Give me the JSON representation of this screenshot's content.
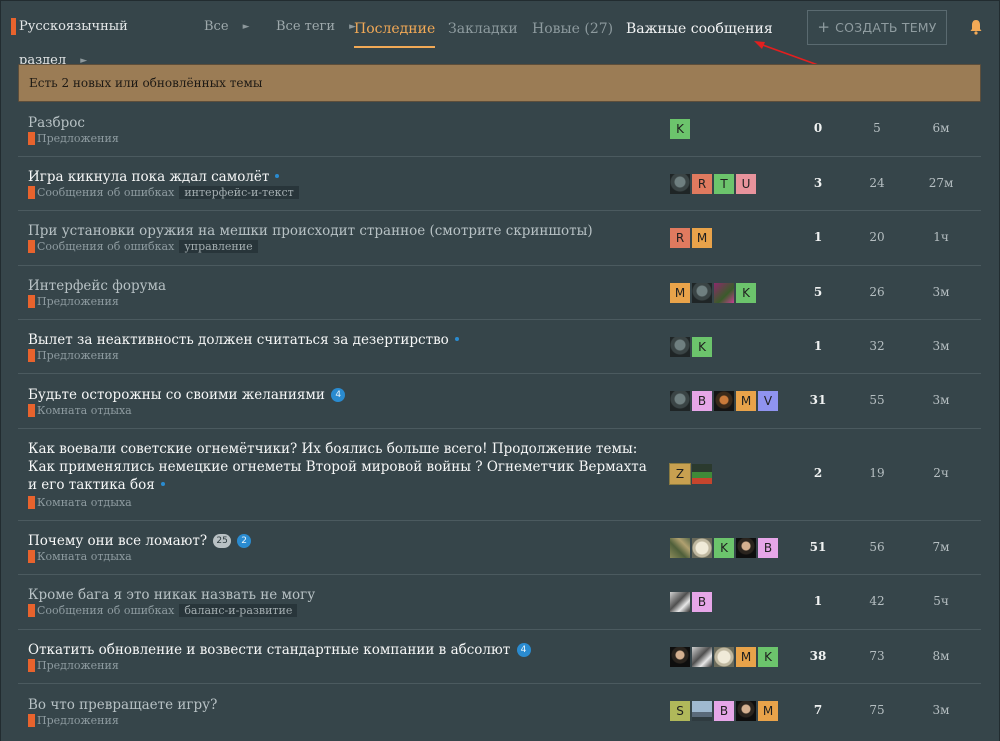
{
  "nav": {
    "category": "Русскоязычный раздел",
    "all": "Все",
    "tags": "Все теги",
    "tabs": [
      "Последние",
      "Закладки",
      "Новые (27)",
      "Важные сообщения"
    ],
    "create": "СОЗДАТЬ ТЕМУ",
    "icons": [
      "caret-right-icon",
      "plus-icon",
      "bell-icon"
    ]
  },
  "banner": "Есть 2 новых или обновлённых темы",
  "colors": {
    "accent": "#f2a956",
    "category": "#e8632d",
    "badge": "#2a8bd0",
    "banner": "#9b7c55",
    "background": "#36454a"
  },
  "topics": [
    {
      "title": "Разброс",
      "unread": false,
      "category": "Предложения",
      "tags": [],
      "badges": [],
      "dot": false,
      "posters": [
        {
          "l": "K",
          "c": "#6cc46c"
        }
      ],
      "replies": "0",
      "views": "5",
      "activity": "6м"
    },
    {
      "title": "Игра кикнула пока ждал самолёт",
      "unread": true,
      "category": "Сообщения об ошибках",
      "tags": [
        "интерфейс-и-текст"
      ],
      "badges": [],
      "dot": true,
      "posters": [
        {
          "img": "soldier"
        },
        {
          "l": "R",
          "c": "#e07a5f"
        },
        {
          "l": "T",
          "c": "#6cc46c"
        },
        {
          "l": "U",
          "c": "#e8939c"
        }
      ],
      "replies": "3",
      "views": "24",
      "activity": "27м"
    },
    {
      "title": "При установки оружия на мешки происходит странное (смотрите скриншоты)",
      "unread": false,
      "category": "Сообщения об ошибках",
      "tags": [
        "управление"
      ],
      "badges": [],
      "dot": false,
      "posters": [
        {
          "l": "R",
          "c": "#e07a5f"
        },
        {
          "l": "M",
          "c": "#e9a34a"
        }
      ],
      "replies": "1",
      "views": "20",
      "activity": "1ч"
    },
    {
      "title": "Интерфейс форума",
      "unread": false,
      "category": "Предложения",
      "tags": [],
      "badges": [],
      "dot": false,
      "posters": [
        {
          "l": "M",
          "c": "#e9a34a"
        },
        {
          "img": "soldier"
        },
        {
          "img": "pink"
        },
        {
          "l": "K",
          "c": "#6cc46c"
        }
      ],
      "replies": "5",
      "views": "26",
      "activity": "3м"
    },
    {
      "title": "Вылет за неактивность должен считаться за дезертирство",
      "unread": true,
      "category": "Предложения",
      "tags": [],
      "badges": [],
      "dot": true,
      "posters": [
        {
          "img": "soldier"
        },
        {
          "l": "K",
          "c": "#6cc46c"
        }
      ],
      "replies": "1",
      "views": "32",
      "activity": "3м"
    },
    {
      "title": "Будьте осторожны со своими желаниями",
      "unread": true,
      "category": "Комната отдыха",
      "tags": [],
      "badges": [
        {
          "t": "4",
          "k": "new"
        }
      ],
      "dot": false,
      "posters": [
        {
          "img": "soldier"
        },
        {
          "l": "B",
          "c": "#e6a6e8"
        },
        {
          "img": "portrait"
        },
        {
          "l": "M",
          "c": "#e9a34a"
        },
        {
          "l": "V",
          "c": "#8f93ef"
        }
      ],
      "replies": "31",
      "views": "55",
      "activity": "3м"
    },
    {
      "title": "Как воевали советские огнемётчики? Их боялись больше всего! Продолжение темы: Как применялись немецкие огнеметы Второй мировой войны ? Огнеметчик Вермахта и его тактика боя",
      "unread": true,
      "category": "Комната отдыха",
      "tags": [],
      "badges": [],
      "dot": true,
      "posters": [
        {
          "l": "Z",
          "c": "#c8a050",
          "lead": true
        },
        {
          "img": "pixel"
        }
      ],
      "replies": "2",
      "views": "19",
      "activity": "2ч"
    },
    {
      "title": "Почему они все ломают?",
      "unread": true,
      "category": "Комната отдыха",
      "tags": [],
      "badges": [
        {
          "t": "25",
          "k": "old"
        },
        {
          "t": "2",
          "k": "new"
        }
      ],
      "dot": false,
      "posters": [
        {
          "img": "camo"
        },
        {
          "img": "dog"
        },
        {
          "l": "K",
          "c": "#6cc46c"
        },
        {
          "img": "face"
        },
        {
          "l": "B",
          "c": "#e6a6e8"
        }
      ],
      "replies": "51",
      "views": "56",
      "activity": "7м"
    },
    {
      "title": "Кроме бага я это никак назвать не могу",
      "unread": false,
      "category": "Сообщения об ошибках",
      "tags": [
        "баланс-и-развитие"
      ],
      "badges": [],
      "dot": false,
      "posters": [
        {
          "img": "bw"
        },
        {
          "l": "B",
          "c": "#e6a6e8"
        }
      ],
      "replies": "1",
      "views": "42",
      "activity": "5ч"
    },
    {
      "title": "Откатить обновление и возвести стандартные компании в абсолют",
      "unread": true,
      "category": "Предложения",
      "tags": [],
      "badges": [
        {
          "t": "4",
          "k": "new"
        }
      ],
      "dot": false,
      "posters": [
        {
          "img": "face"
        },
        {
          "img": "bw"
        },
        {
          "img": "dog"
        },
        {
          "l": "M",
          "c": "#e9a34a"
        },
        {
          "l": "K",
          "c": "#6cc46c"
        }
      ],
      "replies": "38",
      "views": "73",
      "activity": "8м"
    },
    {
      "title": "Во что превращаете игру?",
      "unread": false,
      "category": "Предложения",
      "tags": [],
      "badges": [],
      "dot": false,
      "posters": [
        {
          "l": "S",
          "c": "#b0b85a"
        },
        {
          "img": "sky"
        },
        {
          "l": "B",
          "c": "#e6a6e8"
        },
        {
          "img": "face"
        },
        {
          "l": "M",
          "c": "#e9a34a"
        }
      ],
      "replies": "7",
      "views": "75",
      "activity": "3м"
    }
  ]
}
